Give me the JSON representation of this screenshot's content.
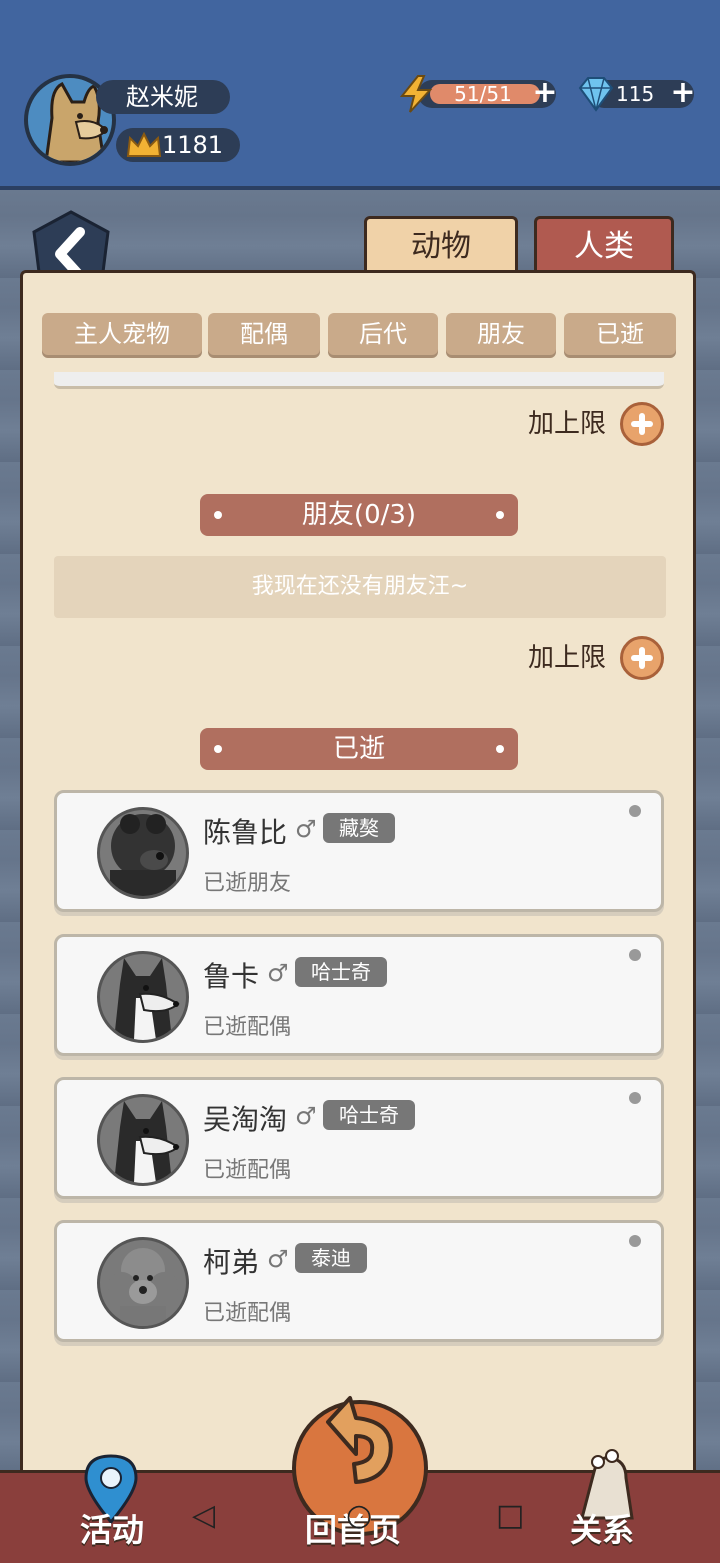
{
  "profile": {
    "name": "赵米妮",
    "crowns": "1181"
  },
  "resources": {
    "energy": "51/51",
    "gems": "115"
  },
  "tabs": {
    "animal": "动物",
    "human": "人类"
  },
  "filters": [
    "主人宠物",
    "配偶",
    "后代",
    "朋友",
    "已逝"
  ],
  "limit_label": "加上限",
  "friends_section": {
    "title": "朋友(0/3)",
    "empty_text": "我现在还没有朋友汪~"
  },
  "deceased_section": {
    "title": "已逝"
  },
  "deceased": [
    {
      "name": "陈鲁比",
      "gender": "♂",
      "breed": "藏獒",
      "status": "已逝朋友"
    },
    {
      "name": "鲁卡",
      "gender": "♂",
      "breed": "哈士奇",
      "status": "已逝配偶"
    },
    {
      "name": "吴淘淘",
      "gender": "♂",
      "breed": "哈士奇",
      "status": "已逝配偶"
    },
    {
      "name": "柯弟",
      "gender": "♂",
      "breed": "泰迪",
      "status": "已逝配偶"
    }
  ],
  "bottom_nav": {
    "left": "活动",
    "center": "回首页",
    "right": "关系"
  },
  "colors": {
    "header": "#41659f",
    "panel": "#f1e4cc",
    "section": "#b06f5f",
    "bottom": "#8a3f3c"
  }
}
